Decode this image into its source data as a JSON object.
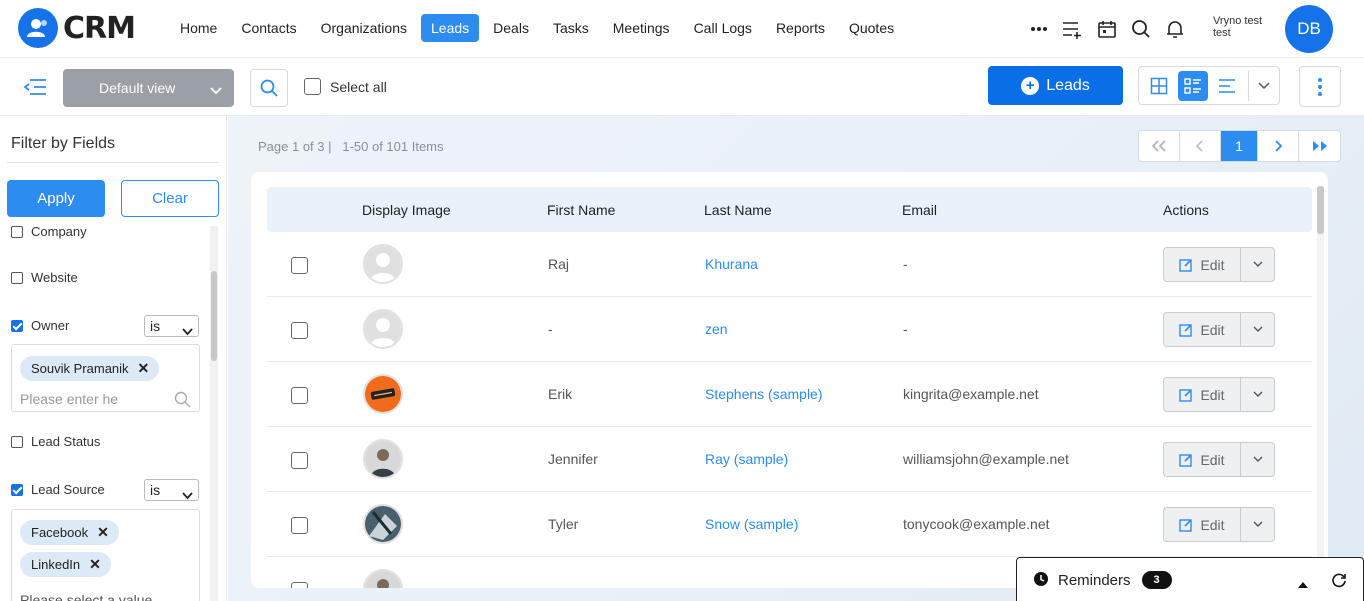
{
  "app": {
    "logo_text": "CRM"
  },
  "nav": {
    "items": [
      {
        "label": "Home",
        "active": false
      },
      {
        "label": "Contacts",
        "active": false
      },
      {
        "label": "Organizations",
        "active": false
      },
      {
        "label": "Leads",
        "active": true
      },
      {
        "label": "Deals",
        "active": false
      },
      {
        "label": "Tasks",
        "active": false
      },
      {
        "label": "Meetings",
        "active": false
      },
      {
        "label": "Call Logs",
        "active": false
      },
      {
        "label": "Reports",
        "active": false
      },
      {
        "label": "Quotes",
        "active": false
      }
    ],
    "more_icon": "ellipsis-icon",
    "tools": [
      "add-list-icon",
      "calendar-icon",
      "search-icon",
      "bell-icon"
    ]
  },
  "user": {
    "name": "Vryno test test",
    "name_line1": "Vryno test",
    "name_line2": "test",
    "initials": "DB"
  },
  "toolbar": {
    "view": "Default view",
    "select_all": "Select all",
    "add_button": "Leads"
  },
  "filter": {
    "title": "Filter by Fields",
    "apply": "Apply",
    "clear": "Clear",
    "fields": {
      "company": {
        "label": "Company",
        "checked": false
      },
      "website": {
        "label": "Website",
        "checked": false
      },
      "owner": {
        "label": "Owner",
        "checked": true,
        "operator": "is",
        "chips": [
          "Souvik Pramanik"
        ],
        "placeholder": "Please enter he"
      },
      "lead_status": {
        "label": "Lead Status",
        "checked": false
      },
      "lead_source": {
        "label": "Lead Source",
        "checked": true,
        "operator": "is",
        "chips": [
          "Facebook",
          "LinkedIn"
        ],
        "placeholder": "Please select a value"
      }
    }
  },
  "pagination": {
    "page_info": "Page 1 of 3",
    "items_info": "|   1-50 of 101 Items",
    "current": "1"
  },
  "table": {
    "headers": [
      "Display Image",
      "First Name",
      "Last Name",
      "Email",
      "Actions"
    ],
    "edit_label": "Edit",
    "rows": [
      {
        "image": "placeholder",
        "first": "Raj",
        "last": "Khurana",
        "email": "-"
      },
      {
        "image": "placeholder",
        "first": "-",
        "last": "zen",
        "email": "-"
      },
      {
        "image": "orange",
        "first": "Erik",
        "last": "Stephens (sample)",
        "email": "kingrita@example.net"
      },
      {
        "image": "person",
        "first": "Jennifer",
        "last": "Ray (sample)",
        "email": "williamsjohn@example.net"
      },
      {
        "image": "abstract",
        "first": "Tyler",
        "last": "Snow (sample)",
        "email": "tonycook@example.net"
      }
    ]
  },
  "reminders": {
    "label": "Reminders",
    "count": "3"
  },
  "colors": {
    "primary": "#2d8cf0",
    "brand": "#1572e8"
  }
}
